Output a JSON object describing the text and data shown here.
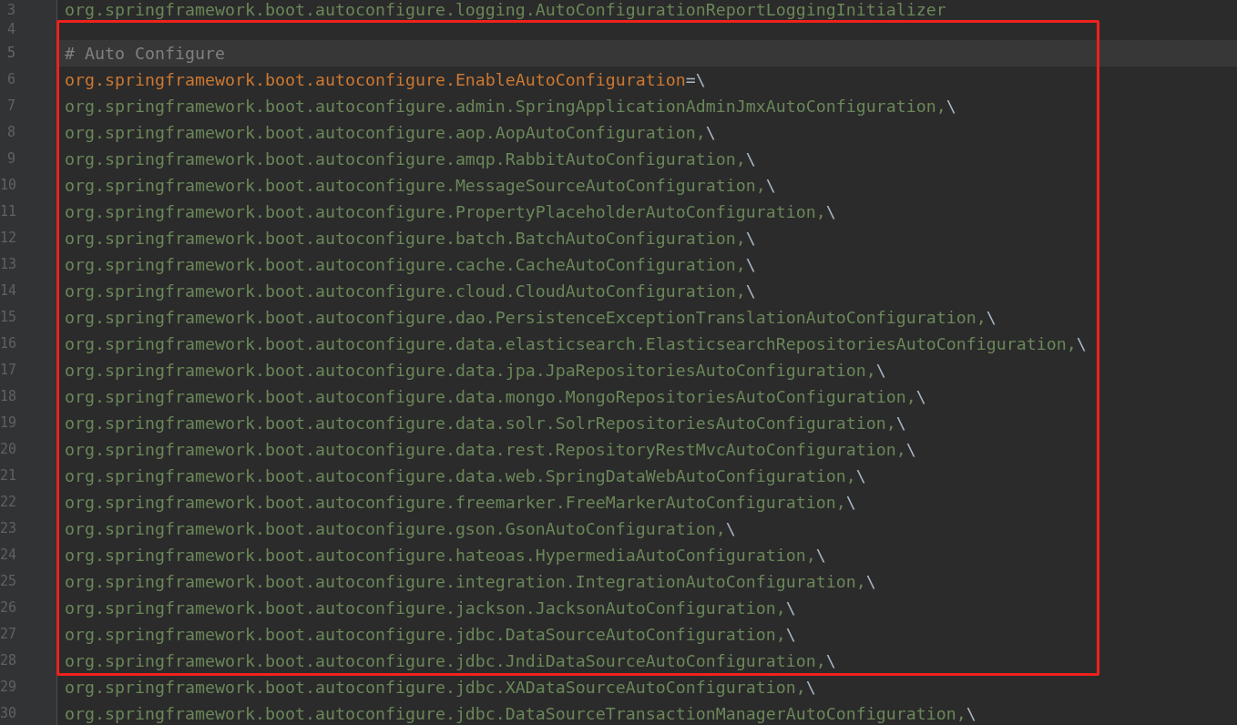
{
  "editor": {
    "blocks": [
      {
        "kind": "plain",
        "lines": [
          {
            "number": "3",
            "current": false,
            "parts": [
              {
                "kind": "value",
                "text": "org.springframework.boot.autoconfigure.logging.AutoConfigurationReportLoggingInitializer"
              }
            ]
          }
        ]
      },
      {
        "kind": "framed",
        "lines": [
          {
            "number": "4",
            "current": false
          },
          {
            "number": "5",
            "current": true,
            "parts": [
              {
                "kind": "comment",
                "text": "# Auto Configure"
              }
            ]
          },
          {
            "number": "6",
            "current": false,
            "parts": [
              {
                "kind": "key",
                "text": "org.springframework.boot.autoconfigure.EnableAutoConfiguration"
              },
              {
                "kind": "operator",
                "text": "="
              },
              {
                "kind": "escape",
                "text": "\\"
              }
            ]
          },
          {
            "number": "7",
            "current": false,
            "parts": [
              {
                "kind": "value",
                "text": "org.springframework.boot.autoconfigure.admin.SpringApplicationAdminJmxAutoConfiguration,"
              },
              {
                "kind": "escape",
                "text": "\\"
              }
            ]
          },
          {
            "number": "8",
            "current": false,
            "parts": [
              {
                "kind": "value",
                "text": "org.springframework.boot.autoconfigure.aop.AopAutoConfiguration,"
              },
              {
                "kind": "escape",
                "text": "\\"
              }
            ]
          },
          {
            "number": "9",
            "current": false,
            "parts": [
              {
                "kind": "value",
                "text": "org.springframework.boot.autoconfigure.amqp.RabbitAutoConfiguration,"
              },
              {
                "kind": "escape",
                "text": "\\"
              }
            ]
          },
          {
            "number": "10",
            "current": false,
            "parts": [
              {
                "kind": "value",
                "text": "org.springframework.boot.autoconfigure.MessageSourceAutoConfiguration,"
              },
              {
                "kind": "escape",
                "text": "\\"
              }
            ]
          },
          {
            "number": "11",
            "current": false,
            "parts": [
              {
                "kind": "value",
                "text": "org.springframework.boot.autoconfigure.PropertyPlaceholderAutoConfiguration,"
              },
              {
                "kind": "escape",
                "text": "\\"
              }
            ]
          },
          {
            "number": "12",
            "current": false,
            "parts": [
              {
                "kind": "value",
                "text": "org.springframework.boot.autoconfigure.batch.BatchAutoConfiguration,"
              },
              {
                "kind": "escape",
                "text": "\\"
              }
            ]
          },
          {
            "number": "13",
            "current": false,
            "parts": [
              {
                "kind": "value",
                "text": "org.springframework.boot.autoconfigure.cache.CacheAutoConfiguration,"
              },
              {
                "kind": "escape",
                "text": "\\"
              }
            ]
          },
          {
            "number": "14",
            "current": false,
            "parts": [
              {
                "kind": "value",
                "text": "org.springframework.boot.autoconfigure.cloud.CloudAutoConfiguration,"
              },
              {
                "kind": "escape",
                "text": "\\"
              }
            ]
          },
          {
            "number": "15",
            "current": false,
            "parts": [
              {
                "kind": "value",
                "text": "org.springframework.boot.autoconfigure.dao.PersistenceExceptionTranslationAutoConfiguration,"
              },
              {
                "kind": "escape",
                "text": "\\"
              }
            ]
          },
          {
            "number": "16",
            "current": false,
            "parts": [
              {
                "kind": "value",
                "text": "org.springframework.boot.autoconfigure.data.elasticsearch.ElasticsearchRepositoriesAutoConfiguration,"
              },
              {
                "kind": "escape",
                "text": "\\"
              }
            ]
          },
          {
            "number": "17",
            "current": false,
            "parts": [
              {
                "kind": "value",
                "text": "org.springframework.boot.autoconfigure.data.jpa.JpaRepositoriesAutoConfiguration,"
              },
              {
                "kind": "escape",
                "text": "\\"
              }
            ]
          },
          {
            "number": "18",
            "current": false,
            "parts": [
              {
                "kind": "value",
                "text": "org.springframework.boot.autoconfigure.data.mongo.MongoRepositoriesAutoConfiguration,"
              },
              {
                "kind": "escape",
                "text": "\\"
              }
            ]
          },
          {
            "number": "19",
            "current": false,
            "parts": [
              {
                "kind": "value",
                "text": "org.springframework.boot.autoconfigure.data.solr.SolrRepositoriesAutoConfiguration,"
              },
              {
                "kind": "escape",
                "text": "\\"
              }
            ]
          },
          {
            "number": "20",
            "current": false,
            "parts": [
              {
                "kind": "value",
                "text": "org.springframework.boot.autoconfigure.data.rest.RepositoryRestMvcAutoConfiguration,"
              },
              {
                "kind": "escape",
                "text": "\\"
              }
            ]
          },
          {
            "number": "21",
            "current": false,
            "parts": [
              {
                "kind": "value",
                "text": "org.springframework.boot.autoconfigure.data.web.SpringDataWebAutoConfiguration,"
              },
              {
                "kind": "escape",
                "text": "\\"
              }
            ]
          },
          {
            "number": "22",
            "current": false,
            "parts": [
              {
                "kind": "value",
                "text": "org.springframework.boot.autoconfigure.freemarker.FreeMarkerAutoConfiguration,"
              },
              {
                "kind": "escape",
                "text": "\\"
              }
            ]
          },
          {
            "number": "23",
            "current": false,
            "parts": [
              {
                "kind": "value",
                "text": "org.springframework.boot.autoconfigure.gson.GsonAutoConfiguration,"
              },
              {
                "kind": "escape",
                "text": "\\"
              }
            ]
          },
          {
            "number": "24",
            "current": false,
            "parts": [
              {
                "kind": "value",
                "text": "org.springframework.boot.autoconfigure.hateoas.HypermediaAutoConfiguration,"
              },
              {
                "kind": "escape",
                "text": "\\"
              }
            ]
          },
          {
            "number": "25",
            "current": false,
            "parts": [
              {
                "kind": "value",
                "text": "org.springframework.boot.autoconfigure.integration.IntegrationAutoConfiguration,"
              },
              {
                "kind": "escape",
                "text": "\\"
              }
            ]
          },
          {
            "number": "26",
            "current": false,
            "parts": [
              {
                "kind": "value",
                "text": "org.springframework.boot.autoconfigure.jackson.JacksonAutoConfiguration,"
              },
              {
                "kind": "escape",
                "text": "\\"
              }
            ]
          },
          {
            "number": "27",
            "current": false,
            "parts": [
              {
                "kind": "value",
                "text": "org.springframework.boot.autoconfigure.jdbc.DataSourceAutoConfiguration,"
              },
              {
                "kind": "escape",
                "text": "\\"
              }
            ]
          },
          {
            "number": "28",
            "current": false,
            "parts": [
              {
                "kind": "value",
                "text": "org.springframework.boot.autoconfigure.jdbc.JndiDataSourceAutoConfiguration,"
              },
              {
                "kind": "escape",
                "text": "\\"
              }
            ]
          }
        ]
      },
      {
        "kind": "plain",
        "lines": [
          {
            "number": "29",
            "current": false,
            "parts": [
              {
                "kind": "value",
                "text": "org.springframework.boot.autoconfigure.jdbc.XADataSourceAutoConfiguration,"
              },
              {
                "kind": "escape",
                "text": "\\"
              }
            ]
          },
          {
            "number": "30",
            "current": false,
            "parts": [
              {
                "kind": "value",
                "text": "org.springframework.boot.autoconfigure.jdbc.DataSourceTransactionManagerAutoConfiguration,"
              },
              {
                "kind": "escape",
                "text": "\\"
              }
            ]
          }
        ]
      }
    ]
  }
}
